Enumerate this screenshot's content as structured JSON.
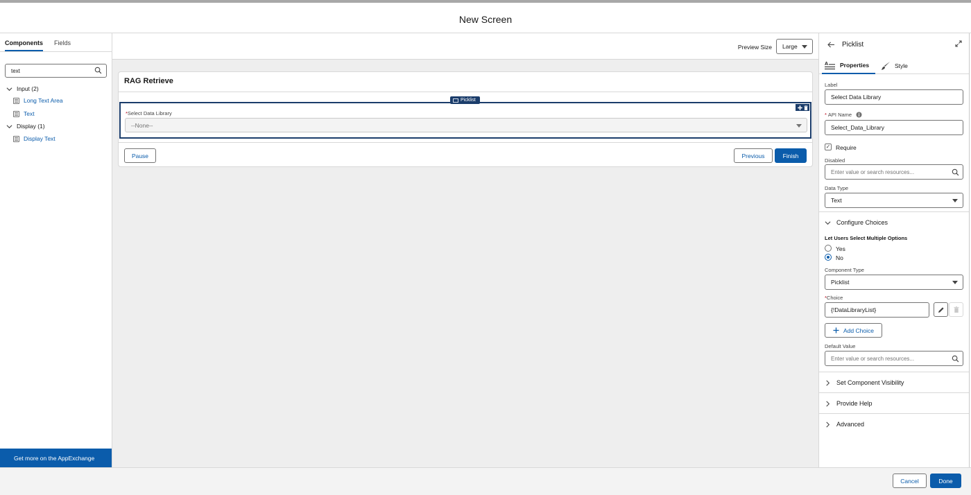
{
  "title": "New Screen",
  "left": {
    "tabs": [
      "Components",
      "Fields"
    ],
    "search_value": "text",
    "groups": [
      {
        "label": "Input (2)",
        "items": [
          "Long Text Area",
          "Text"
        ]
      },
      {
        "label": "Display (1)",
        "items": [
          "Display Text"
        ]
      }
    ],
    "appexchange": "Get more on the AppExchange"
  },
  "center": {
    "preview_label": "Preview Size",
    "preview_value": "Large",
    "card_title": "RAG Retrieve",
    "picklist_tag": "Picklist",
    "field_required_mark": "*",
    "field_label": "Select Data Library",
    "field_value": "--None--",
    "buttons": {
      "pause": "Pause",
      "previous": "Previous",
      "finish": "Finish"
    }
  },
  "right": {
    "header": "Picklist",
    "tabs": {
      "properties": "Properties",
      "style": "Style"
    },
    "label_lbl": "Label",
    "label_value": "Select Data Library",
    "api_req": "*",
    "api_lbl": "API Name",
    "api_value": "Select_Data_Library",
    "require_lbl": "Require",
    "disabled_lbl": "Disabled",
    "disabled_placeholder": "Enter value or search resources...",
    "datatype_lbl": "Data Type",
    "datatype_value": "Text",
    "configure_choices": "Configure Choices",
    "multi_lbl": "Let Users Select Multiple Options",
    "yes": "Yes",
    "no": "No",
    "component_type_lbl": "Component Type",
    "component_type_value": "Picklist",
    "choice_req": "*",
    "choice_lbl": "Choice",
    "choice_value": "{!DataLibraryList}",
    "add_choice": "Add Choice",
    "default_value_lbl": "Default Value",
    "default_value_placeholder": "Enter value or search resources...",
    "sections": [
      "Set Component Visibility",
      "Provide Help",
      "Advanced"
    ]
  },
  "footer": {
    "cancel": "Cancel",
    "done": "Done"
  },
  "colors": {
    "brand": "#0b5cab",
    "selection": "#1b3d6b",
    "canvas": "#eeeeee"
  }
}
